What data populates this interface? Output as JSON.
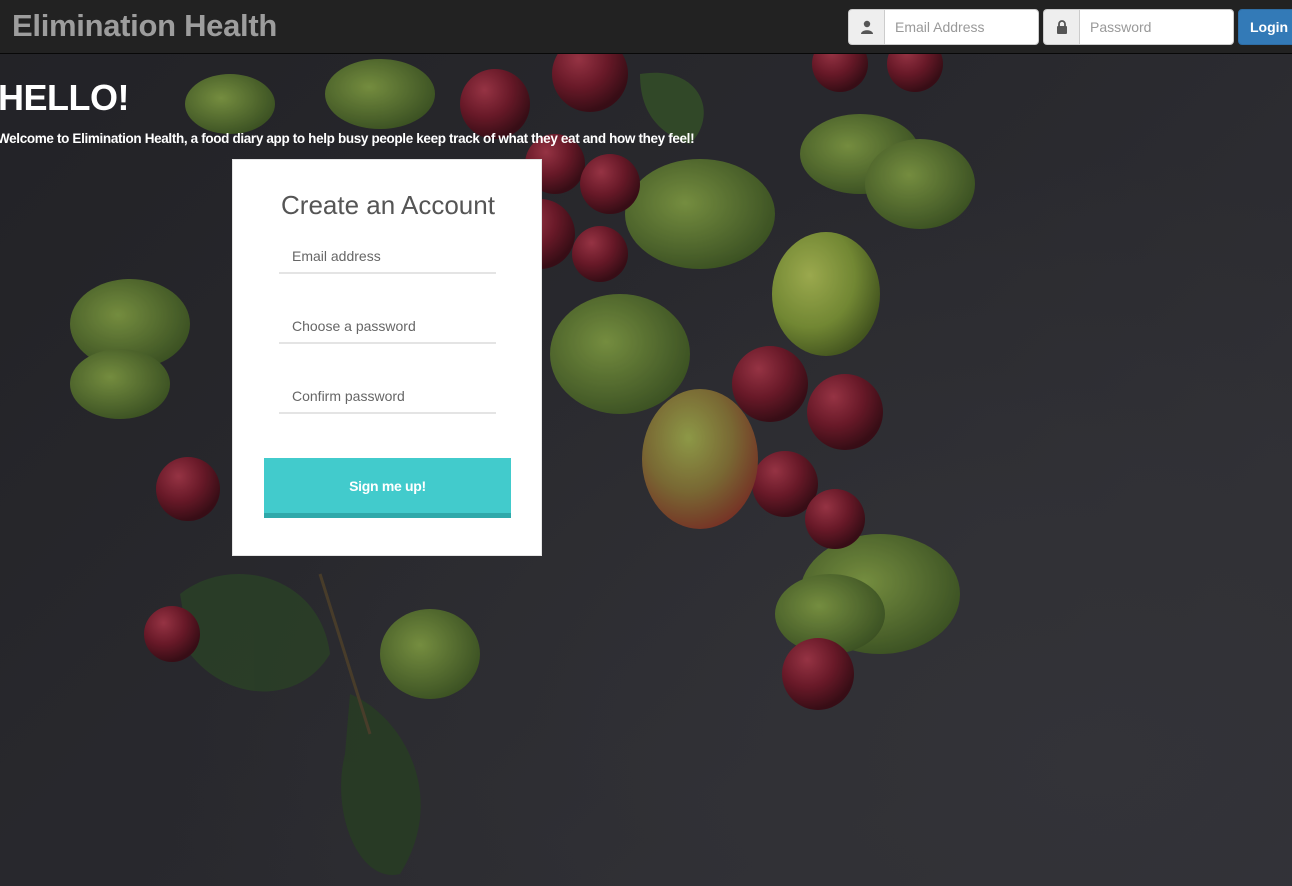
{
  "navbar": {
    "brand": "Elimination Health",
    "email_placeholder": "Email Address",
    "password_placeholder": "Password",
    "login_label": "Login",
    "user_icon": "user-icon",
    "lock_icon": "lock-icon"
  },
  "hero": {
    "heading": "HELLO!",
    "tagline": "Welcome to Elimination Health, a food diary app to help busy people keep track of what they eat and how they feel!"
  },
  "signup": {
    "title": "Create an Account",
    "email_placeholder": "Email address",
    "password_placeholder": "Choose a password",
    "confirm_placeholder": "Confirm password",
    "submit_label": "Sign me up!"
  },
  "colors": {
    "navbar_bg": "#222222",
    "brand_text": "#9d9d9d",
    "login_button": "#337ab7",
    "signup_button": "#42cbcc",
    "background": "#2b2b30"
  }
}
